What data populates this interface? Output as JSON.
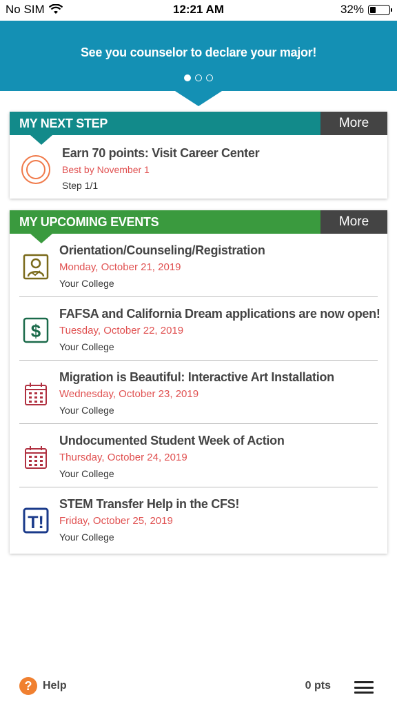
{
  "status_bar": {
    "carrier": "No SIM",
    "time": "12:21 AM",
    "battery_percent": "32%",
    "battery_level": 0.32
  },
  "banner": {
    "message": "See you counselor to declare your major!",
    "pages": 3,
    "active_page": 1,
    "color": "#1490b4"
  },
  "next_step": {
    "header": "MY NEXT STEP",
    "more_label": "More",
    "color": "#128a8a",
    "item": {
      "icon": "target-circle-icon",
      "title": "Earn 70 points: Visit Career Center",
      "due": "Best by November 1",
      "progress": "Step 1/1"
    }
  },
  "events": {
    "header": "MY UPCOMING EVENTS",
    "more_label": "More",
    "color": "#3a9a3e",
    "items": [
      {
        "icon": "counselor-profile-icon",
        "title": "Orientation/Counseling/Registration",
        "date": "Monday, October 21, 2019",
        "location": "Your College"
      },
      {
        "icon": "dollar-sign-icon",
        "title": "FAFSA and California Dream applications are now open!",
        "date": "Tuesday, October 22, 2019",
        "location": "Your College"
      },
      {
        "icon": "calendar-icon",
        "title": "Migration is Beautiful: Interactive Art Installation",
        "date": "Wednesday, October 23, 2019",
        "location": "Your College"
      },
      {
        "icon": "calendar-icon",
        "title": "Undocumented Student Week of Action",
        "date": "Thursday, October 24, 2019",
        "location": "Your College"
      },
      {
        "icon": "t-exclamation-icon",
        "title": "STEM Transfer Help in the CFS!",
        "date": "Friday, October 25, 2019",
        "location": "Your College"
      }
    ]
  },
  "footer": {
    "help_label": "Help",
    "points": "0 pts",
    "help_color": "#f08030"
  }
}
